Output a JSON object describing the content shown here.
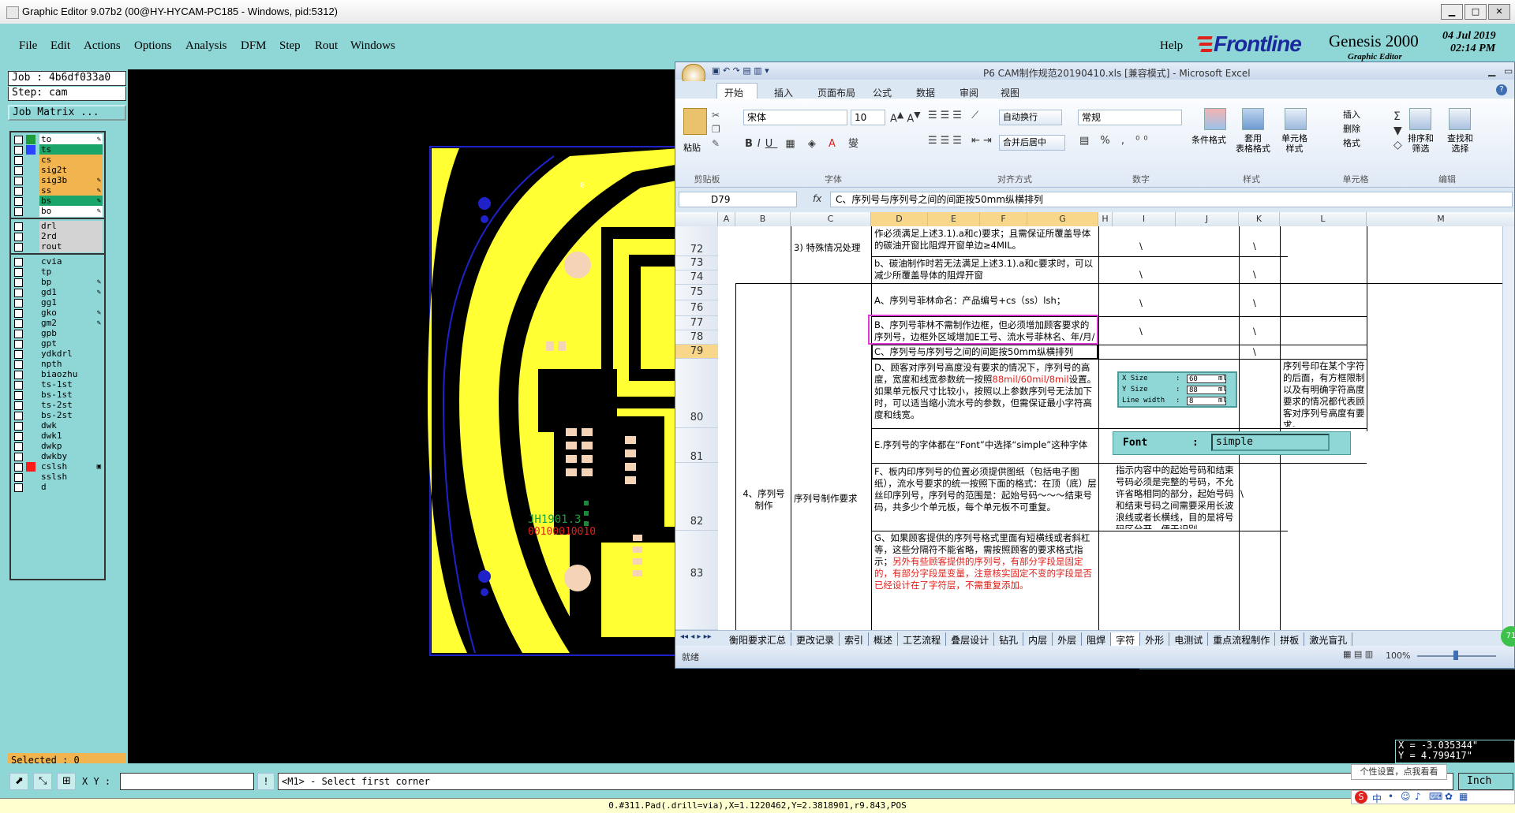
{
  "window": {
    "title": "Graphic Editor 9.07b2 (00@HY-HYCAM-PC185 - Windows, pid:5312)",
    "min": "▁",
    "max": "□",
    "close": "✕"
  },
  "menu": {
    "file": "File",
    "edit": "Edit",
    "actions": "Actions",
    "options": "Options",
    "analysis": "Analysis",
    "dfm": "DFM",
    "step": "Step",
    "rout": "Rout",
    "windows": "Windows",
    "help": "Help"
  },
  "logo": {
    "brand": "Frontline",
    "product": "Genesis 2000",
    "subtitle": "Graphic Editor",
    "date": "04 Jul 2019",
    "time": "02:14 PM"
  },
  "panel": {
    "job": "Job : 4b6df033a0",
    "step": "Step: cam",
    "job_matrix": "Job Matrix ...",
    "selected": "Selected : 0"
  },
  "layers": [
    {
      "name": "to",
      "color": "#ffffff",
      "sw": "#1e9b3b",
      "mark": "✎"
    },
    {
      "name": "ts",
      "color": "#1aa66a",
      "sw": "#2a44ff",
      "mark": ""
    },
    {
      "name": "cs",
      "color": "#f2b44f",
      "sw": "#8fd6d6",
      "mark": ""
    },
    {
      "name": "sig2t",
      "color": "#f2b44f",
      "sw": "#8fd6d6",
      "mark": ""
    },
    {
      "name": "sig3b",
      "color": "#f2b44f",
      "sw": "#8fd6d6",
      "mark": "✎"
    },
    {
      "name": "ss",
      "color": "#f2b44f",
      "sw": "#8fd6d6",
      "mark": "✎"
    },
    {
      "name": "bs",
      "color": "#1aa66a",
      "sw": "#8fd6d6",
      "mark": "✎"
    },
    {
      "name": "bo",
      "color": "#ffffff",
      "sw": "#8fd6d6",
      "mark": "✎"
    },
    {
      "name": "drl",
      "color": "#d3d3d3",
      "sw": "#8fd6d6",
      "mark": ""
    },
    {
      "name": "2rd",
      "color": "#d3d3d3",
      "sw": "#8fd6d6",
      "mark": ""
    },
    {
      "name": "rout",
      "color": "#d3d3d3",
      "sw": "#8fd6d6",
      "mark": ""
    },
    {
      "name": "cvia",
      "color": "#8fd6d6",
      "sw": "#8fd6d6",
      "mark": ""
    },
    {
      "name": "tp",
      "color": "#8fd6d6",
      "sw": "#8fd6d6",
      "mark": ""
    },
    {
      "name": "bp",
      "color": "#8fd6d6",
      "sw": "#8fd6d6",
      "mark": "✎"
    },
    {
      "name": "gd1",
      "color": "#8fd6d6",
      "sw": "#8fd6d6",
      "mark": "✎"
    },
    {
      "name": "gg1",
      "color": "#8fd6d6",
      "sw": "#8fd6d6",
      "mark": ""
    },
    {
      "name": "gko",
      "color": "#8fd6d6",
      "sw": "#8fd6d6",
      "mark": "✎"
    },
    {
      "name": "gm2",
      "color": "#8fd6d6",
      "sw": "#8fd6d6",
      "mark": "✎"
    },
    {
      "name": "gpb",
      "color": "#8fd6d6",
      "sw": "#8fd6d6",
      "mark": ""
    },
    {
      "name": "gpt",
      "color": "#8fd6d6",
      "sw": "#8fd6d6",
      "mark": ""
    },
    {
      "name": "ydkdrl",
      "color": "#8fd6d6",
      "sw": "#8fd6d6",
      "mark": ""
    },
    {
      "name": "npth",
      "color": "#8fd6d6",
      "sw": "#8fd6d6",
      "mark": ""
    },
    {
      "name": "biaozhu",
      "color": "#8fd6d6",
      "sw": "#8fd6d6",
      "mark": ""
    },
    {
      "name": "ts-1st",
      "color": "#8fd6d6",
      "sw": "#8fd6d6",
      "mark": ""
    },
    {
      "name": "bs-1st",
      "color": "#8fd6d6",
      "sw": "#8fd6d6",
      "mark": ""
    },
    {
      "name": "ts-2st",
      "color": "#8fd6d6",
      "sw": "#8fd6d6",
      "mark": ""
    },
    {
      "name": "bs-2st",
      "color": "#8fd6d6",
      "sw": "#8fd6d6",
      "mark": ""
    },
    {
      "name": "dwk",
      "color": "#8fd6d6",
      "sw": "#8fd6d6",
      "mark": ""
    },
    {
      "name": "dwk1",
      "color": "#8fd6d6",
      "sw": "#8fd6d6",
      "mark": ""
    },
    {
      "name": "dwkp",
      "color": "#8fd6d6",
      "sw": "#8fd6d6",
      "mark": ""
    },
    {
      "name": "dwkby",
      "color": "#8fd6d6",
      "sw": "#8fd6d6",
      "mark": ""
    },
    {
      "name": "cslsh",
      "color": "#8fd6d6",
      "sw": "#ff1a1a",
      "mark": "▣"
    },
    {
      "name": "sslsh",
      "color": "#8fd6d6",
      "sw": "#8fd6d6",
      "mark": ""
    },
    {
      "name": "d",
      "color": "#8fd6d6",
      "sw": "#8fd6d6",
      "mark": ""
    }
  ],
  "board": {
    "text1": "JH1901.3",
    "text2": "00100010010",
    "origin": "0"
  },
  "coords": {
    "x": "X = -3.035344\"",
    "y": "Y = 4.799417\""
  },
  "bottom": {
    "xy_label": "X Y :",
    "xy_value": "",
    "excl": "!",
    "prompt": "<M1> - Select first corner",
    "status": "0.#311.Pad(.drill=via),X=1.1220462,Y=2.3818901,r9.843,POS",
    "unit": "Inch",
    "tooltip": "个性设置，点我看看",
    "ime": "中"
  },
  "excel": {
    "title": "P6 CAM制作规范20190410.xls  [兼容模式] - Microsoft Excel",
    "tabs": [
      "开始",
      "插入",
      "页面布局",
      "公式",
      "数据",
      "审阅",
      "视图"
    ],
    "font_name": "宋体",
    "font_size": "10",
    "number_format": "常规",
    "paste": "粘贴",
    "wrap": "自动换行",
    "merge": "合并后居中",
    "cond_format": "条件格式",
    "table_format": "套用\n表格格式",
    "cell_style": "单元格\n样式",
    "insert": "插入",
    "delete": "删除",
    "format": "格式",
    "sort": "排序和\n筛选",
    "find": "查找和\n选择",
    "groups": [
      "剪贴板",
      "字体",
      "对齐方式",
      "数字",
      "样式",
      "单元格",
      "编辑"
    ],
    "namebox": "D79",
    "fx": "fx",
    "formula": "C、序列号与序列号之间的间距按50mm纵横排列",
    "columns": [
      "A",
      "B",
      "C",
      "D",
      "E",
      "F",
      "G",
      "H",
      "I",
      "J",
      "K",
      "L",
      "M"
    ],
    "rows": [
      "72",
      "73",
      "74",
      "75",
      "76",
      "77",
      "78",
      "79",
      "80",
      "81",
      "82",
      "83"
    ],
    "cells": {
      "c72": "3) 特殊情况处理",
      "d72": "作必须满足上述3.1).a和c)要求；且需保证所覆盖导体的碳油开窗比阻焊开窗单边≥4MIL。",
      "d73": "b、碳油制作时若无法满足上述3.1).a和c要求时，可以减少所覆盖导体的阻焊开窗",
      "d75": "A、序列号菲林命名：产品编号+cs（ss）lsh；",
      "d77": "B、序列号菲林不需制作边框，但必须增加顾客要求的序列号，边框外区域增加E工号、流水号菲林名、年/月/日；",
      "d79": "C、序列号与序列号之间的间距按50mm纵横排列",
      "d80_a": "D、顾客对序列号高度没有要求的情况下，序列号的高度，宽度和线宽参数统一按照",
      "d80_red": "88mil/60mil/8mil",
      "d80_b": "设置。如果单元板尺寸比较小，按照以上参数序列号无法加下时，可以适当缩小流水号的参数，但需保证最小字符高度和线宽。",
      "l80": "序列号印在某个字符的后面，有方框限制以及有明确字符高度要求的情况都代表顾客对序列号高度有要求。",
      "d81": "E.序列号的字体都在“Font”中选择“simple”这种字体",
      "b82": "4、序列号制作",
      "c82": "序列号制作要求",
      "d82": "F、板内印序列号的位置必须提供图纸（包括电子图纸），流水号要求的统一按照下面的格式：在顶（底）层丝印序列号，序列号的范围是：起始号码～～～结束号码，共多少个单元板，每个单元板不可重复。",
      "i82": "指示内容中的起始号码和结束号码必须是完整的号码，不允许省略相同的部分，起始号码和结束号码之间需要采用长波浪线或者长横线，目的是将号码区分开，便于识别。",
      "d83_a": "G、如果顾客提供的序列号格式里面有短横线或者斜杠等，这些分隔符不能省略，需按照顾客的要求格式指示；",
      "d83_red": "另外有些顾客提供的序列号，有部分字段是固定的，有部分字段是变量，注意核实固定不变的字段是否已经设计在了字符层，不需重复添加。",
      "slash": "\\"
    },
    "size_box": {
      "x_label": "X Size",
      "x_val": "60",
      "x_unit": "ml",
      "y_label": "Y Size",
      "y_val": "88",
      "y_unit": "ml",
      "w_label": "Line width",
      "w_val": "8",
      "w_unit": "ml",
      "colon": ":"
    },
    "font_box": {
      "label": "Font",
      "colon": ":",
      "value": "simple"
    },
    "sheet_tabs": [
      "衡阳要求汇总",
      "更改记录",
      "索引",
      "概述",
      "工艺流程",
      "叠层设计",
      "钻孔",
      "内层",
      "外层",
      "阻焊",
      "字符",
      "外形",
      "电测试",
      "重点流程制作",
      "拼板",
      "激光盲孔"
    ],
    "status": "就绪",
    "zoom": "100%"
  },
  "colors": {
    "genesis_bg": "#8fd6d6",
    "board_yellow": "#ffff33",
    "outline_blue": "#1f22c9",
    "highlight_magenta": "#e03ad6",
    "excel_selected": "#f9d78a"
  }
}
